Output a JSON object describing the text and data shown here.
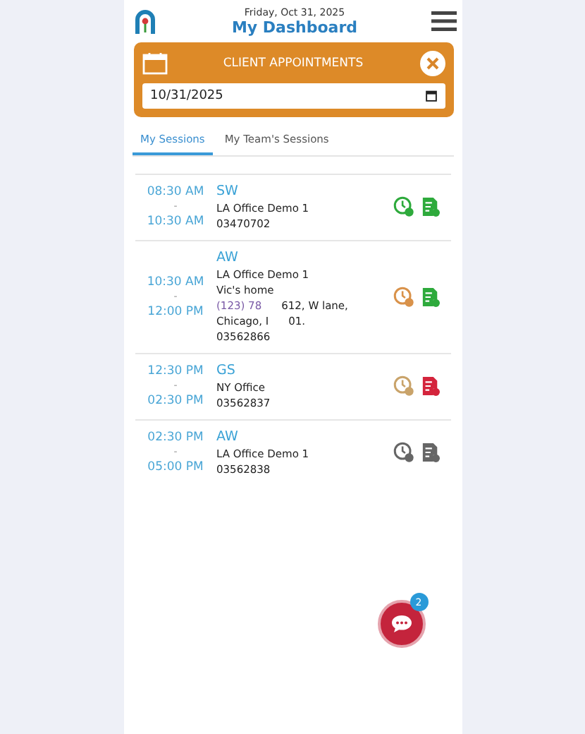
{
  "header": {
    "date": "Friday, Oct 31, 2025",
    "title": "My Dashboard"
  },
  "panel": {
    "title": "CLIENT APPOINTMENTS",
    "date_value": "10/31/2025"
  },
  "tabs": [
    {
      "label": "My Sessions",
      "selected": true
    },
    {
      "label": "My Team's Sessions",
      "selected": false
    }
  ],
  "sessions": [
    {
      "start": "08:30 AM",
      "sep": "-",
      "end": "10:30 AM",
      "code": "SW",
      "lines": [
        [
          "LA Office Demo 1"
        ],
        [
          "03470702"
        ]
      ],
      "clock": {
        "color": "#2eaa3c"
      },
      "form": {
        "color": "#2eaa3c"
      }
    },
    {
      "start": "10:30 AM",
      "sep": "-",
      "end": "12:00 PM",
      "code": "AW",
      "lines": [
        [
          "LA Office Demo 1"
        ],
        [
          "Vic's home"
        ],
        [
          "(123) 78",
          "612, W lane,"
        ],
        [
          "Chicago, I",
          "01."
        ],
        [
          "03562866"
        ]
      ],
      "clock": {
        "color": "#d9924a"
      },
      "form": {
        "color": "#2eaa3c"
      }
    },
    {
      "start": "12:30 PM",
      "sep": "-",
      "end": "02:30 PM",
      "code": "GS",
      "lines": [
        [
          "NY Office"
        ],
        [
          "03562837"
        ]
      ],
      "clock": {
        "color": "#c9a36a"
      },
      "form": {
        "color": "#d4243c"
      }
    },
    {
      "start": "02:30 PM",
      "sep": "-",
      "end": "05:00 PM",
      "code": "AW",
      "lines": [
        [
          "LA Office Demo 1"
        ],
        [
          "03562838"
        ]
      ],
      "clock": {
        "color": "#666666"
      },
      "form": {
        "color": "#666666"
      }
    }
  ],
  "chat": {
    "badge": "2"
  }
}
